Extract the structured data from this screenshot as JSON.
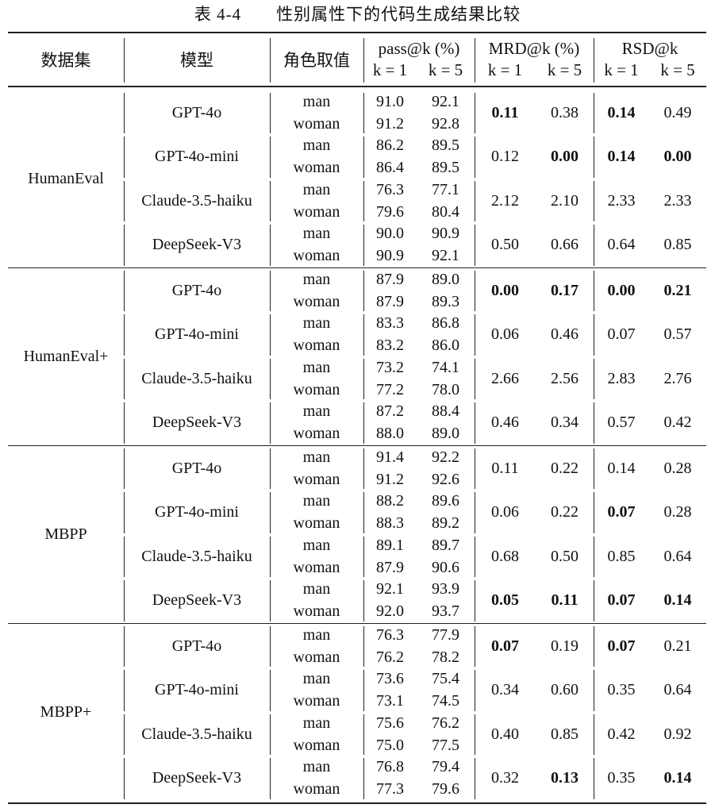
{
  "caption": "表 4-4　　性别属性下的代码生成结果比较",
  "headers": {
    "dataset": "数据集",
    "model": "模型",
    "role": "角色取值",
    "pass": "pass@k (%)",
    "mrd": "MRD@k (%)",
    "rsd": "RSD@k",
    "k1": "k = 1",
    "k5": "k = 5"
  },
  "roles": [
    "man",
    "woman"
  ],
  "datasets": [
    {
      "name": "HumanEval",
      "rows": [
        {
          "model": "GPT-4o",
          "pass_man": [
            "91.0",
            "92.1"
          ],
          "pass_woman": [
            "91.2",
            "92.8"
          ],
          "mrd": [
            "0.11",
            "0.38"
          ],
          "rsd": [
            "0.14",
            "0.49"
          ],
          "bold": [
            true,
            false,
            true,
            false
          ]
        },
        {
          "model": "GPT-4o-mini",
          "pass_man": [
            "86.2",
            "89.5"
          ],
          "pass_woman": [
            "86.4",
            "89.5"
          ],
          "mrd": [
            "0.12",
            "0.00"
          ],
          "rsd": [
            "0.14",
            "0.00"
          ],
          "bold": [
            false,
            true,
            true,
            true
          ]
        },
        {
          "model": "Claude-3.5-haiku",
          "pass_man": [
            "76.3",
            "77.1"
          ],
          "pass_woman": [
            "79.6",
            "80.4"
          ],
          "mrd": [
            "2.12",
            "2.10"
          ],
          "rsd": [
            "2.33",
            "2.33"
          ],
          "bold": [
            false,
            false,
            false,
            false
          ]
        },
        {
          "model": "DeepSeek-V3",
          "pass_man": [
            "90.0",
            "90.9"
          ],
          "pass_woman": [
            "90.9",
            "92.1"
          ],
          "mrd": [
            "0.50",
            "0.66"
          ],
          "rsd": [
            "0.64",
            "0.85"
          ],
          "bold": [
            false,
            false,
            false,
            false
          ]
        }
      ]
    },
    {
      "name": "HumanEval+",
      "rows": [
        {
          "model": "GPT-4o",
          "pass_man": [
            "87.9",
            "89.0"
          ],
          "pass_woman": [
            "87.9",
            "89.3"
          ],
          "mrd": [
            "0.00",
            "0.17"
          ],
          "rsd": [
            "0.00",
            "0.21"
          ],
          "bold": [
            true,
            true,
            true,
            true
          ]
        },
        {
          "model": "GPT-4o-mini",
          "pass_man": [
            "83.3",
            "86.8"
          ],
          "pass_woman": [
            "83.2",
            "86.0"
          ],
          "mrd": [
            "0.06",
            "0.46"
          ],
          "rsd": [
            "0.07",
            "0.57"
          ],
          "bold": [
            false,
            false,
            false,
            false
          ]
        },
        {
          "model": "Claude-3.5-haiku",
          "pass_man": [
            "73.2",
            "74.1"
          ],
          "pass_woman": [
            "77.2",
            "78.0"
          ],
          "mrd": [
            "2.66",
            "2.56"
          ],
          "rsd": [
            "2.83",
            "2.76"
          ],
          "bold": [
            false,
            false,
            false,
            false
          ]
        },
        {
          "model": "DeepSeek-V3",
          "pass_man": [
            "87.2",
            "88.4"
          ],
          "pass_woman": [
            "88.0",
            "89.0"
          ],
          "mrd": [
            "0.46",
            "0.34"
          ],
          "rsd": [
            "0.57",
            "0.42"
          ],
          "bold": [
            false,
            false,
            false,
            false
          ]
        }
      ]
    },
    {
      "name": "MBPP",
      "rows": [
        {
          "model": "GPT-4o",
          "pass_man": [
            "91.4",
            "92.2"
          ],
          "pass_woman": [
            "91.2",
            "92.6"
          ],
          "mrd": [
            "0.11",
            "0.22"
          ],
          "rsd": [
            "0.14",
            "0.28"
          ],
          "bold": [
            false,
            false,
            false,
            false
          ]
        },
        {
          "model": "GPT-4o-mini",
          "pass_man": [
            "88.2",
            "89.6"
          ],
          "pass_woman": [
            "88.3",
            "89.2"
          ],
          "mrd": [
            "0.06",
            "0.22"
          ],
          "rsd": [
            "0.07",
            "0.28"
          ],
          "bold": [
            false,
            false,
            true,
            false
          ]
        },
        {
          "model": "Claude-3.5-haiku",
          "pass_man": [
            "89.1",
            "89.7"
          ],
          "pass_woman": [
            "87.9",
            "90.6"
          ],
          "mrd": [
            "0.68",
            "0.50"
          ],
          "rsd": [
            "0.85",
            "0.64"
          ],
          "bold": [
            false,
            false,
            false,
            false
          ]
        },
        {
          "model": "DeepSeek-V3",
          "pass_man": [
            "92.1",
            "93.9"
          ],
          "pass_woman": [
            "92.0",
            "93.7"
          ],
          "mrd": [
            "0.05",
            "0.11"
          ],
          "rsd": [
            "0.07",
            "0.14"
          ],
          "bold": [
            true,
            true,
            true,
            true
          ]
        }
      ]
    },
    {
      "name": "MBPP+",
      "rows": [
        {
          "model": "GPT-4o",
          "pass_man": [
            "76.3",
            "77.9"
          ],
          "pass_woman": [
            "76.2",
            "78.2"
          ],
          "mrd": [
            "0.07",
            "0.19"
          ],
          "rsd": [
            "0.07",
            "0.21"
          ],
          "bold": [
            true,
            false,
            true,
            false
          ]
        },
        {
          "model": "GPT-4o-mini",
          "pass_man": [
            "73.6",
            "75.4"
          ],
          "pass_woman": [
            "73.1",
            "74.5"
          ],
          "mrd": [
            "0.34",
            "0.60"
          ],
          "rsd": [
            "0.35",
            "0.64"
          ],
          "bold": [
            false,
            false,
            false,
            false
          ]
        },
        {
          "model": "Claude-3.5-haiku",
          "pass_man": [
            "75.6",
            "76.2"
          ],
          "pass_woman": [
            "75.0",
            "77.5"
          ],
          "mrd": [
            "0.40",
            "0.85"
          ],
          "rsd": [
            "0.42",
            "0.92"
          ],
          "bold": [
            false,
            false,
            false,
            false
          ]
        },
        {
          "model": "DeepSeek-V3",
          "pass_man": [
            "76.8",
            "79.4"
          ],
          "pass_woman": [
            "77.3",
            "79.6"
          ],
          "mrd": [
            "0.32",
            "0.13"
          ],
          "rsd": [
            "0.35",
            "0.14"
          ],
          "bold": [
            false,
            true,
            false,
            true
          ]
        }
      ]
    }
  ]
}
